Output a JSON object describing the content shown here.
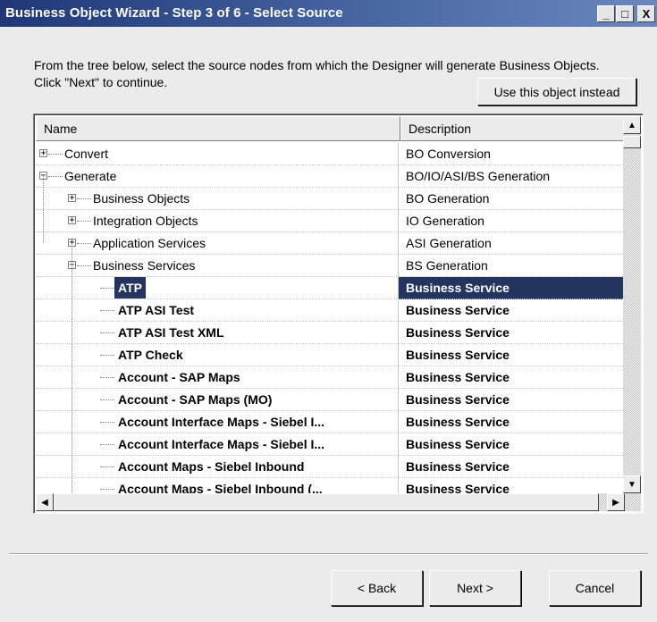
{
  "window": {
    "title": "Business Object Wizard - Step 3 of 6 - Select Source",
    "minimize_glyph": "_",
    "maximize_glyph": "□",
    "close_glyph": "X"
  },
  "instructions": "From the tree below, select the source nodes from which the Designer will generate Business Objects. Click \"Next\" to continue.",
  "use_object_button": "Use this object instead",
  "columns": {
    "name": "Name",
    "description": "Description"
  },
  "rows": [
    {
      "name": "Convert",
      "description": "BO Conversion",
      "level": 0,
      "expander": "+"
    },
    {
      "name": "Generate",
      "description": "BO/IO/ASI/BS Generation",
      "level": 0,
      "expander": "−"
    },
    {
      "name": "Business Objects",
      "description": "BO Generation",
      "level": 1,
      "expander": "+"
    },
    {
      "name": "Integration Objects",
      "description": "IO Generation",
      "level": 1,
      "expander": "+"
    },
    {
      "name": "Application Services",
      "description": "ASI Generation",
      "level": 1,
      "expander": "+"
    },
    {
      "name": "Business Services",
      "description": "BS Generation",
      "level": 1,
      "expander": "−"
    },
    {
      "name": "ATP",
      "description": "Business Service",
      "level": 2,
      "selected": true
    },
    {
      "name": "ATP ASI Test",
      "description": "Business Service",
      "level": 2
    },
    {
      "name": "ATP ASI Test XML",
      "description": "Business Service",
      "level": 2
    },
    {
      "name": "ATP Check",
      "description": "Business Service",
      "level": 2
    },
    {
      "name": "Account - SAP Maps",
      "description": "Business Service",
      "level": 2
    },
    {
      "name": "Account - SAP Maps (MO)",
      "description": "Business Service",
      "level": 2
    },
    {
      "name": "Account Interface Maps - Siebel I...",
      "description": "Business Service",
      "level": 2
    },
    {
      "name": "Account Interface Maps - Siebel I...",
      "description": "Business Service",
      "level": 2
    },
    {
      "name": "Account Maps - Siebel Inbound",
      "description": "Business Service",
      "level": 2
    },
    {
      "name": "Account Maps - Siebel Inbound (...",
      "description": "Business Service",
      "level": 2
    }
  ],
  "buttons": {
    "back": "< Back",
    "next": "Next >",
    "cancel": "Cancel"
  },
  "colors": {
    "selection": "#23355f",
    "titlebar": "#1f3777"
  },
  "icons": {
    "expand": "plus-box-icon",
    "collapse": "minus-box-icon",
    "scroll_up": "arrow-up-icon",
    "scroll_down": "arrow-down-icon",
    "scroll_left": "arrow-left-icon",
    "scroll_right": "arrow-right-icon"
  }
}
